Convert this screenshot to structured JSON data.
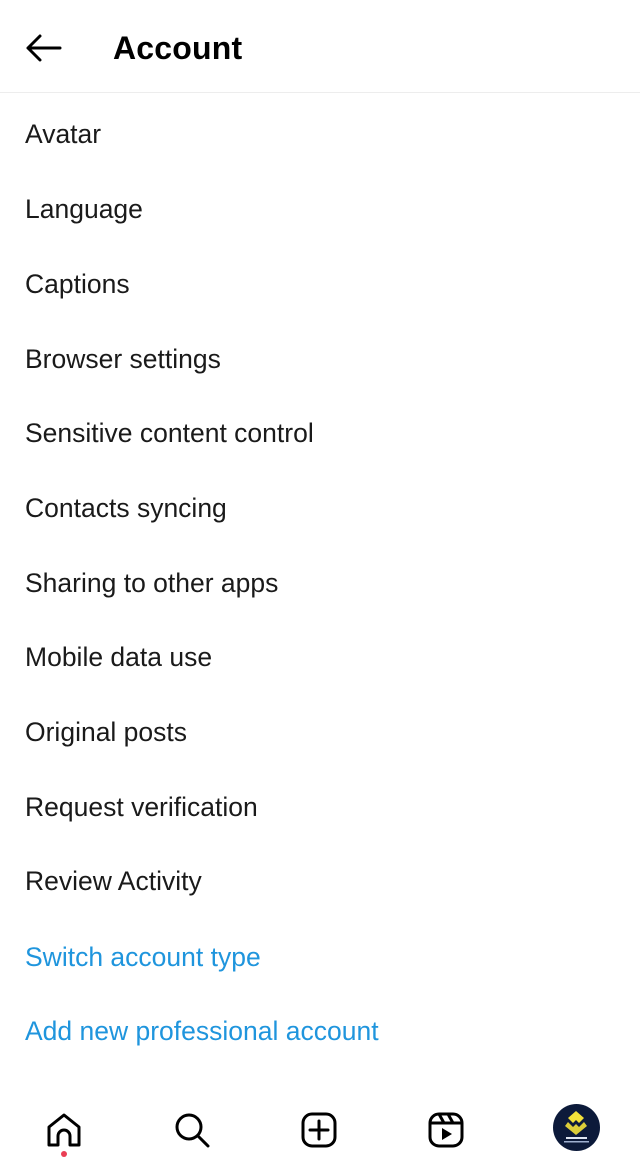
{
  "header": {
    "title": "Account",
    "back_icon": "arrow-left-icon"
  },
  "menu": {
    "items": [
      {
        "label": "Avatar",
        "style": "default"
      },
      {
        "label": "Language",
        "style": "default"
      },
      {
        "label": "Captions",
        "style": "default"
      },
      {
        "label": "Browser settings",
        "style": "default"
      },
      {
        "label": "Sensitive content control",
        "style": "default"
      },
      {
        "label": "Contacts syncing",
        "style": "default"
      },
      {
        "label": "Sharing to other apps",
        "style": "default"
      },
      {
        "label": "Mobile data use",
        "style": "default"
      },
      {
        "label": "Original posts",
        "style": "default"
      },
      {
        "label": "Request verification",
        "style": "default"
      },
      {
        "label": "Review Activity",
        "style": "default"
      },
      {
        "label": "Switch account type",
        "style": "link"
      },
      {
        "label": "Add new professional account",
        "style": "link"
      }
    ]
  },
  "bottom_nav": {
    "items": [
      {
        "name": "home",
        "icon": "home-icon",
        "has_notification_dot": true
      },
      {
        "name": "search",
        "icon": "search-icon"
      },
      {
        "name": "create",
        "icon": "plus-square-icon"
      },
      {
        "name": "reels",
        "icon": "reels-icon"
      },
      {
        "name": "profile",
        "icon": "avatar"
      }
    ]
  },
  "colors": {
    "link": "#1f95dd",
    "text": "#1a1a1a",
    "notification_dot": "#ea3e54",
    "avatar_bg": "#0c1a3a",
    "avatar_logo": "#f2e13a"
  }
}
